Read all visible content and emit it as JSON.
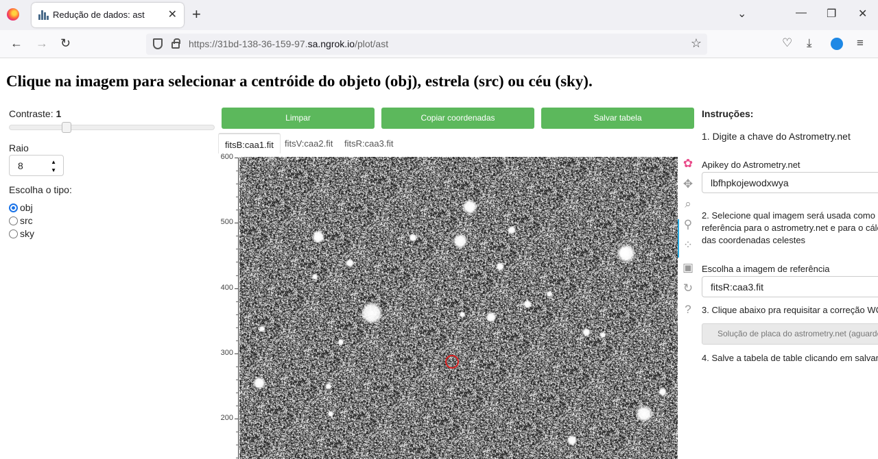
{
  "browser": {
    "tab_title": "Redução de dados: ast",
    "url_prefix": "https://31bd-138-36-159-97.",
    "url_domain": "sa.ngrok.io",
    "url_path": "/plot/ast"
  },
  "page": {
    "title": "Clique na imagem para selecionar a centróide do objeto (obj), estrela (src) ou céu (sky)."
  },
  "controls": {
    "contrast_label": "Contraste:",
    "contrast_value": "1",
    "contrast_level": 0.27,
    "radius_label": "Raio",
    "radius_value": "8",
    "type_label": "Escolha o tipo:",
    "types": [
      {
        "label": "obj",
        "selected": true
      },
      {
        "label": "src",
        "selected": false
      },
      {
        "label": "sky",
        "selected": false
      }
    ]
  },
  "actions": {
    "clear": "Limpar",
    "copy": "Copiar coordenadas",
    "save": "Salvar tabela"
  },
  "image_tabs": [
    "fitsB:caa1.fit",
    "fitsV:caa2.fit",
    "fitsR:caa3.fit"
  ],
  "active_image_tab": 0,
  "plot": {
    "y_ticks": [
      "600",
      "500",
      "400",
      "300",
      "200"
    ],
    "y_min": 140,
    "y_max": 600,
    "selected_marker_color": "#d62020"
  },
  "instructions": {
    "heading": "Instruções:",
    "step1": "1. Digite a chave do Astrometry.net",
    "apikey_label": "Apikey do Astrometry.net",
    "apikey_value": "lbfhpkojewodxwya",
    "step2_line1": "2. Selecione qual imagem será usada como",
    "step2_line2": "referência para o astrometry.net e para o cálc",
    "step2_line3": "das coordenadas celestes",
    "ref_label": "Escolha a imagem de referência",
    "ref_value": "fitsR:caa3.fit",
    "step3": "3. Clique abaixo pra requisitar a correção WC",
    "solve_button": "Solução de placa do astrometry.net (aguarde",
    "step4": "4. Salve a tabela de table clicando em salvar"
  },
  "icons": {
    "toolbar": [
      "bokeh-logo-icon",
      "pan-icon",
      "zoom-icon",
      "wheel-zoom-icon",
      "tap-select-icon",
      "save-icon",
      "reset-icon",
      "help-icon"
    ]
  }
}
